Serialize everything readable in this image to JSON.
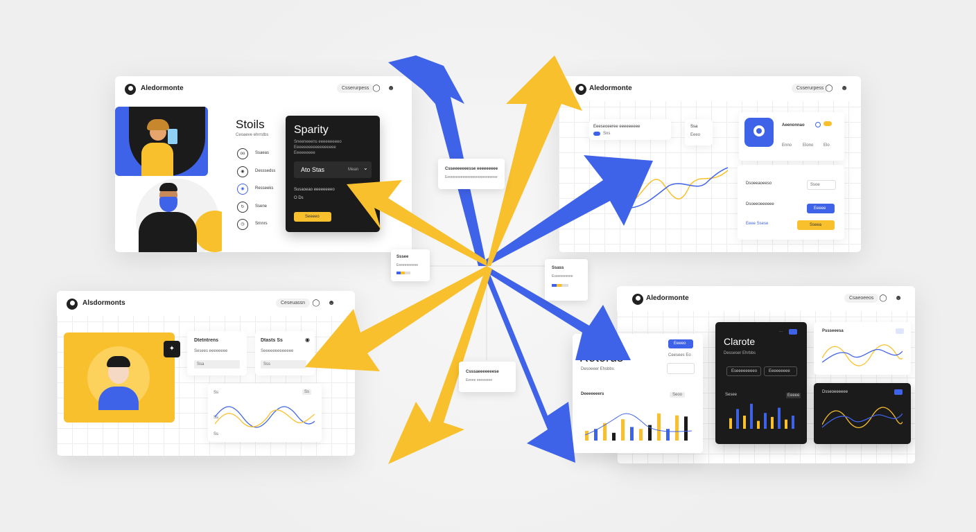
{
  "colors": {
    "blue": "#3f63e8",
    "yellow": "#f9c02d",
    "dark": "#1b1b1b"
  },
  "panel_tl": {
    "brand": "Aledormonte",
    "pill": "Csserurpess",
    "heading": "Stoils",
    "subheading": "Ceoaeve ehrrstbs",
    "list": [
      "Ssaeas",
      "Desssedss",
      "Resseeks",
      "Ssene",
      "Srnnrs"
    ],
    "dark_card": {
      "title": "Sparity",
      "sub1": "Sneeneeens eeeeeeeeeo",
      "sub2": "Eeeeeeeeeeeeeeeeee",
      "sub3": "Eeeeeeeee",
      "select_label": "Ato Stas",
      "select_value": "Mean",
      "bottom_label": "Susaoeao eeeeeeeeo",
      "toggle": "O  Ds",
      "button": "Seeeeo"
    }
  },
  "panel_tr": {
    "brand": "Aledormonte",
    "pill": "Csserurpess",
    "mini1": "Eeeseoeeree eeeeeeeee",
    "mini1b": "Sns",
    "mini2": "Ssa",
    "mini2b": "Eeeo",
    "feature_title": "Aeenonnao",
    "feature_tabs": [
      "Enno",
      "Elono",
      "Elo"
    ],
    "form_label1": "Dsoeeaoeeso",
    "form_value1": "Ssoe",
    "form_label2": "Dsoeeoeeeeee",
    "form_btn_blue": "Eeeee",
    "form_row3": "Eeee  Ssese",
    "form_btn_yellow": "Sseea"
  },
  "panel_bl": {
    "brand": "Alsdormonts",
    "pill": "Ceseuassn",
    "card1_title": "Dtetntrens",
    "card1_sub": "Sesees eeeeeeee",
    "card1_field": "Ssa",
    "card2_title": "Dtasts Ss",
    "card2_sub": "Seeeeeeeeeeeee",
    "card2_field": "Sss",
    "chart_badge": "Ss",
    "chart_labels": [
      "Ss",
      "Ss",
      "Ss"
    ]
  },
  "panel_br": {
    "brand": "Aledormonte",
    "pill": "Csaeoeeos",
    "returns_tag": "Ssseeeeeoe",
    "returns_btn": "Eeeeo",
    "returns_title": "Retorus",
    "returns_sub": "Desoeeer Ehsbbs",
    "returns_chip": "Ceesees  Eo",
    "returns_chart_title": "Deeeeeeers",
    "returns_chart_tag": "Seoo",
    "clarote_title": "Clarote",
    "clarote_sub": "Desseser Ehrbbs",
    "clarote_btn1": "Eseeeeeeeeo",
    "clarote_btn2": "Eeeeeeeee",
    "clarote_chart_title": "Sesee",
    "clarote_chart_tag": "Eeeee",
    "wave_title": "Pssseeesa",
    "wave_dark_title": "Dsseoeeeeee"
  },
  "callouts": [
    {
      "title": "Csseeeeeeesse eeeeeeeee",
      "sub": "Eeeeeeeeeeeeeeeeeeeeeeeeeee"
    },
    {
      "title": "Sssee",
      "sub": "Eeeeeeeeeee"
    },
    {
      "title": "Ssass",
      "sub": "Esseeeeeeee"
    },
    {
      "title": "Csssaeeeeeeese",
      "sub": "Eeeee eeeeeeee"
    }
  ],
  "icons": [
    "user-icon",
    "user-icon",
    "refresh-icon",
    "sparkle-icon",
    "bulb-icon",
    "chevron-down-icon"
  ]
}
